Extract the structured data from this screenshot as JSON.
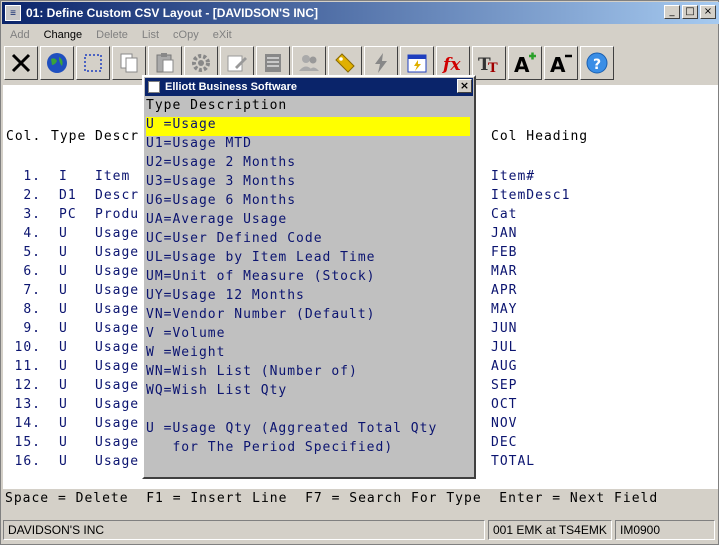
{
  "window": {
    "title": "01: Define Custom CSV Layout - [DAVIDSON'S INC]",
    "buttons": {
      "minimize": "_",
      "maximize": "□",
      "close": "×"
    }
  },
  "menu": [
    {
      "label": "Add",
      "enabled": false
    },
    {
      "label": "Change",
      "enabled": true
    },
    {
      "label": "Delete",
      "enabled": false
    },
    {
      "label": "List",
      "enabled": false
    },
    {
      "label": "cOpy",
      "enabled": false
    },
    {
      "label": "eXit",
      "enabled": false
    }
  ],
  "toolbar": [
    "close-icon",
    "globe-icon",
    "select-icon",
    "copy-icon",
    "paste-icon",
    "settings-icon",
    "edit-icon",
    "list-icon",
    "users-icon",
    "tag-icon",
    "lightning-icon",
    "calendar-icon",
    "function-icon",
    "font-style-icon",
    "font-increase-icon",
    "font-decrease-icon",
    "help-icon"
  ],
  "table": {
    "headers": {
      "col": "Col.",
      "type": "Type",
      "desc": "Descr",
      "heading": "Col Heading"
    },
    "rows": [
      {
        "col": "1.",
        "type": "I",
        "desc": "Item",
        "heading": "Item#"
      },
      {
        "col": "2.",
        "type": "D1",
        "desc": "Descr",
        "heading": "ItemDesc1"
      },
      {
        "col": "3.",
        "type": "PC",
        "desc": "Produ",
        "heading": "Cat"
      },
      {
        "col": "4.",
        "type": "U",
        "desc": "Usage",
        "heading": "JAN"
      },
      {
        "col": "5.",
        "type": "U",
        "desc": "Usage",
        "heading": "FEB"
      },
      {
        "col": "6.",
        "type": "U",
        "desc": "Usage",
        "heading": "MAR"
      },
      {
        "col": "7.",
        "type": "U",
        "desc": "Usage",
        "heading": "APR"
      },
      {
        "col": "8.",
        "type": "U",
        "desc": "Usage",
        "heading": "MAY"
      },
      {
        "col": "9.",
        "type": "U",
        "desc": "Usage",
        "heading": "JUN"
      },
      {
        "col": "10.",
        "type": "U",
        "desc": "Usage",
        "heading": "JUL"
      },
      {
        "col": "11.",
        "type": "U",
        "desc": "Usage",
        "heading": "AUG"
      },
      {
        "col": "12.",
        "type": "U",
        "desc": "Usage",
        "heading": "SEP"
      },
      {
        "col": "13.",
        "type": "U",
        "desc": "Usage",
        "heading": "OCT"
      },
      {
        "col": "14.",
        "type": "U",
        "desc": "Usage",
        "heading": "NOV"
      },
      {
        "col": "15.",
        "type": "U",
        "desc": "Usage",
        "heading": "DEC"
      },
      {
        "col": "16.",
        "type": "U",
        "desc": "Usage",
        "heading": "TOTAL"
      }
    ]
  },
  "popup": {
    "title": "Elliott Business Software",
    "close": "×",
    "header": "Type Description",
    "items": [
      "U =Usage",
      "U1=Usage MTD",
      "U2=Usage 2 Months",
      "U3=Usage 3 Months",
      "U6=Usage 6 Months",
      "UA=Average Usage",
      "UC=User Defined Code",
      "UL=Usage by Item Lead Time",
      "UM=Unit of Measure (Stock)",
      "UY=Usage 12 Months",
      "VN=Vendor Number (Default)",
      "V =Volume",
      "W =Weight",
      "WN=Wish List (Number of)",
      "WQ=Wish List Qty",
      "",
      "U =Usage Qty (Aggreated Total Qty",
      "   for The Period Specified)"
    ],
    "selected_index": 0
  },
  "fkeys": "Space = Delete  F1 = Insert Line  F7 = Search For Type  Enter = Next Field",
  "status": {
    "company": "DAVIDSON'S INC",
    "session": "001 EMK at TS4EMK",
    "screen": "IM0900"
  },
  "colors": {
    "text_blue": "#0b1470",
    "selection": "#ffff00",
    "popup_bg": "#c0c0c0"
  }
}
